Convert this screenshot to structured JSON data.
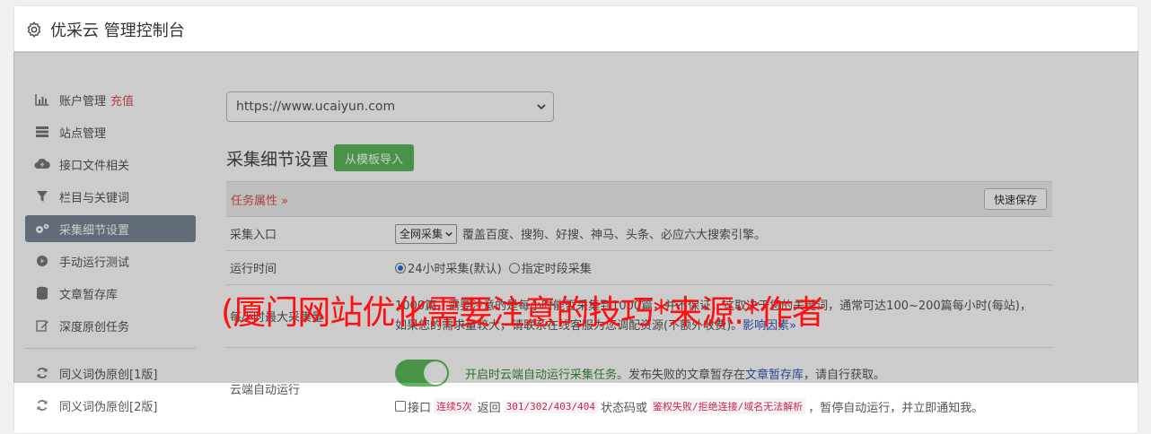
{
  "header": {
    "title": "优采云 管理控制台",
    "icon": "gear-icon"
  },
  "sidebar": {
    "items": [
      {
        "label": "账户管理",
        "badge": "充值",
        "icon": "bar-chart-icon"
      },
      {
        "label": "站点管理",
        "icon": "server-list-icon"
      },
      {
        "label": "接口文件相关",
        "icon": "cloud-upload-icon"
      },
      {
        "label": "栏目与关键词",
        "icon": "filter-icon"
      },
      {
        "label": "采集细节设置",
        "icon": "gears-icon",
        "active": true
      },
      {
        "label": "手动运行测试",
        "icon": "play-circle-icon"
      },
      {
        "label": "文章暂存库",
        "icon": "database-icon"
      },
      {
        "label": "深度原创任务",
        "icon": "edit-icon"
      },
      {
        "label": "同义词伪原创[1版]",
        "icon": "refresh-icon"
      },
      {
        "label": "同义词伪原创[2版]",
        "icon": "refresh-icon"
      }
    ]
  },
  "main": {
    "site_select": {
      "value": "https://www.ucaiyun.com"
    },
    "section_title": "采集细节设置",
    "import_button": "从模板导入",
    "task_attr": "任务属性 »",
    "quick_save": "快速保存",
    "rows": {
      "entry": {
        "label": "采集入口",
        "select_value": "全网采集",
        "description": "覆盖百度、搜狗、好搜、神马、头条、必应六大搜索引擎。"
      },
      "runtime": {
        "label": "运行时间",
        "option1": "24小时采集(默认)",
        "option2": "指定时段采集"
      },
      "max_volume": {
        "label": "每小时最大采集量",
        "line1": "1000篇，需要注意的是每小时能否采集到1000篇，并不保证，这取决于您的关键词，通常可达100~200篇每小时(每站)，",
        "line2": "如果您的需求量较大，请联系在线客服为您调配资源(不额外收费)。",
        "link": "影响因素»"
      },
      "cloud": {
        "label": "云端自动运行",
        "toggle_text": "开启时云端自动运行采集任务。",
        "text_after": "发布失败的文章暂存在",
        "link": "文章暂存库",
        "text_end": "，请自行获取。",
        "check_prefix": "接口",
        "code1": "连续5次",
        "text_back": "返回",
        "code2": "301/302/403/404",
        "text_status": "状态码或",
        "code3": "鉴权失败/拒绝连接/域名无法解析",
        "text_tail": "，暂停自动运行，并立即通知我。"
      }
    }
  },
  "watermark": "(厦门网站优化需要注意的技巧*来源:*作者"
}
